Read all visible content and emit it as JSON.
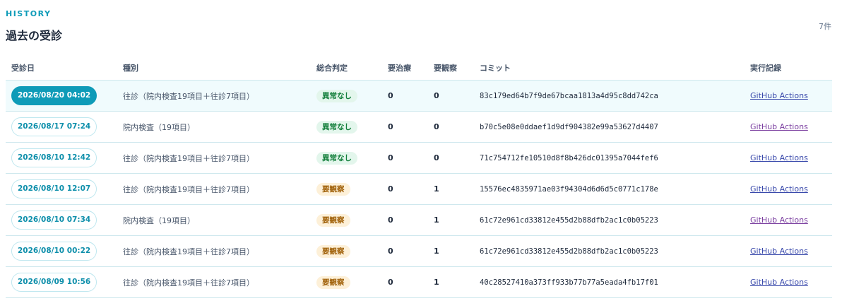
{
  "section": {
    "eyebrow": "HISTORY",
    "title": "過去の受診",
    "count": "7件"
  },
  "table": {
    "headers": {
      "date": "受診日",
      "kind": "種別",
      "verdict": "総合判定",
      "treatment": "要治療",
      "observation": "要観察",
      "commit": "コミット",
      "log": "実行記録"
    },
    "rows": [
      {
        "date": "2026/08/20 04:02",
        "kind": "往診（院内検査19項目＋往診7項目）",
        "verdict": "異常なし",
        "treatment": "0",
        "observation": "0",
        "commit": "83c179ed64b7f9de67bcaa1813a4d95c8dd742ca",
        "log": "GitHub Actions"
      },
      {
        "date": "2026/08/17 07:24",
        "kind": "院内検査（19項目）",
        "verdict": "異常なし",
        "treatment": "0",
        "observation": "0",
        "commit": "b70c5e08e0ddaef1d9df904382e99a53627d4407",
        "log": "GitHub Actions"
      },
      {
        "date": "2026/08/10 12:42",
        "kind": "往診（院内検査19項目＋往診7項目）",
        "verdict": "異常なし",
        "treatment": "0",
        "observation": "0",
        "commit": "71c754712fe10510d8f8b426dc01395a7044fef6",
        "log": "GitHub Actions"
      },
      {
        "date": "2026/08/10 12:07",
        "kind": "往診（院内検査19項目＋往診7項目）",
        "verdict": "要観察",
        "treatment": "0",
        "observation": "1",
        "commit": "15576ec4835971ae03f94304d6d6d5c0771c178e",
        "log": "GitHub Actions"
      },
      {
        "date": "2026/08/10 07:34",
        "kind": "院内検査（19項目）",
        "verdict": "要観察",
        "treatment": "0",
        "observation": "1",
        "commit": "61c72e961cd33812e455d2b88dfb2ac1c0b05223",
        "log": "GitHub Actions"
      },
      {
        "date": "2026/08/10 00:22",
        "kind": "往診（院内検査19項目＋往診7項目）",
        "verdict": "要観察",
        "treatment": "0",
        "observation": "1",
        "commit": "61c72e961cd33812e455d2b88dfb2ac1c0b05223",
        "log": "GitHub Actions"
      },
      {
        "date": "2026/08/09 10:56",
        "kind": "往診（院内検査19項目＋往診7項目）",
        "verdict": "要観察",
        "treatment": "0",
        "observation": "1",
        "commit": "40c28527410a373ff933b77b77a5eada4fb17f01",
        "log": "GitHub Actions"
      }
    ]
  },
  "colors": {
    "accent": "#0e9bb8",
    "ok_bg": "#e3f6ec",
    "ok_text": "#15803d",
    "watch_bg": "#fdf0d8",
    "watch_text": "#a1620b",
    "link": "#3949ab",
    "link_visited": "#7b3fa0"
  }
}
